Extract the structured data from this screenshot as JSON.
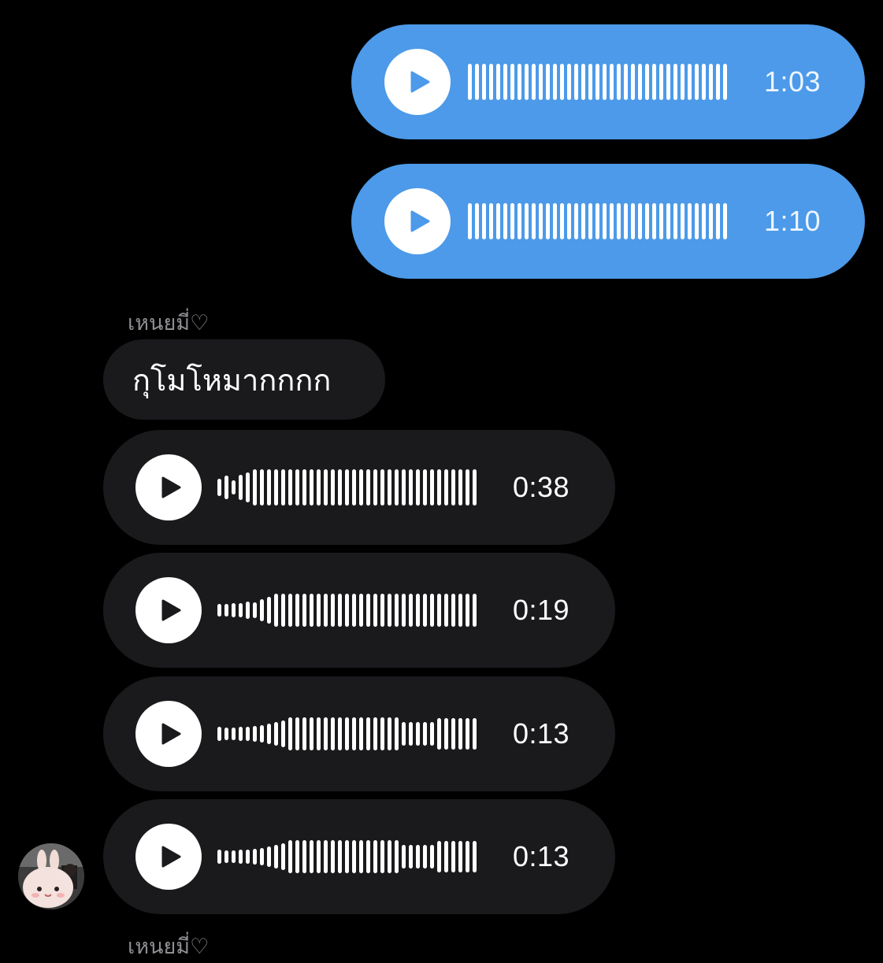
{
  "colors": {
    "background": "#000000",
    "sent_bubble": "#4c9ae9",
    "received_bubble": "#1a1a1c",
    "sent_icon": "#4c9ae9",
    "received_icon": "#1a1a1c",
    "sender_name": "#8e8e93"
  },
  "sent_messages": [
    {
      "type": "voice",
      "duration": "1:03",
      "play_icon": "play-icon"
    },
    {
      "type": "voice",
      "duration": "1:10",
      "play_icon": "play-icon"
    }
  ],
  "received_group": {
    "sender_name": "เหนยมี่♡",
    "text_message": "กุโมโหมากกกก",
    "voice_messages": [
      {
        "duration": "0:38",
        "play_icon": "play-icon"
      },
      {
        "duration": "0:19",
        "play_icon": "play-icon"
      },
      {
        "duration": "0:13",
        "play_icon": "play-icon"
      },
      {
        "duration": "0:13",
        "play_icon": "play-icon"
      }
    ],
    "avatar_icon": "bunny-avatar-icon"
  },
  "next_sender_name": "เหนยมี่♡"
}
